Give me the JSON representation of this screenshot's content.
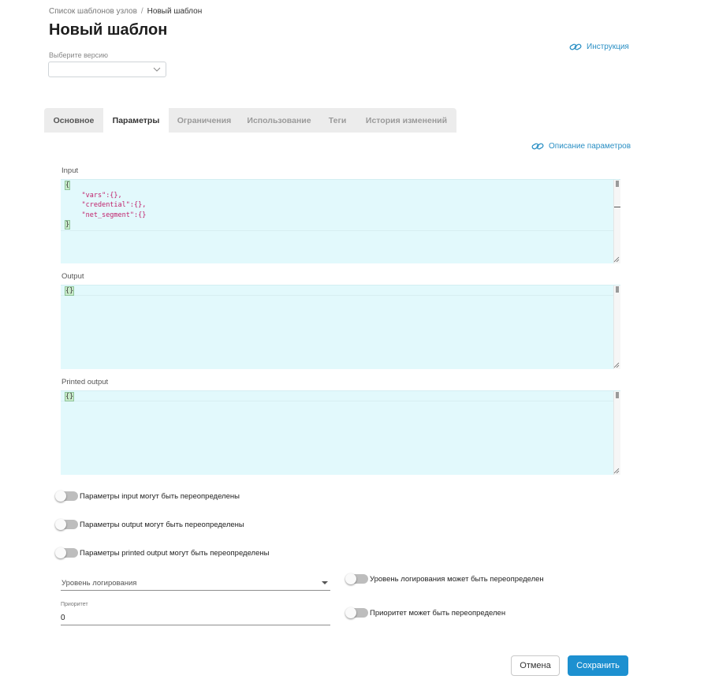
{
  "breadcrumb": {
    "parent": "Список шаблонов узлов",
    "separator": "/",
    "current": "Новый шаблон"
  },
  "page_title": "Новый шаблон",
  "version": {
    "label": "Выберите версию",
    "value": ""
  },
  "links": {
    "instruction": "Инструкция",
    "params_description": "Описание параметров"
  },
  "tabs": [
    {
      "label": "Основное",
      "active": false
    },
    {
      "label": "Параметры",
      "active": true
    },
    {
      "label": "Ограничения",
      "active": false
    },
    {
      "label": "Использование",
      "active": false
    },
    {
      "label": "Теги",
      "active": false
    },
    {
      "label": "История изменений",
      "active": false
    }
  ],
  "editors": {
    "input": {
      "label": "Input",
      "lines": [
        "{",
        "\"vars\":{},",
        "\"credential\":{},",
        "\"net_segment\":{}",
        "}"
      ]
    },
    "output": {
      "label": "Output",
      "value": "{}"
    },
    "printed": {
      "label": "Printed output",
      "value": "{}"
    }
  },
  "toggles": {
    "input_override": "Параметры input могут быть переопределены",
    "output_override": "Параметры output могут быть переопределены",
    "printed_override": "Параметры printed output могут быть переопределены",
    "log_level_override": "Уровень логирования может быть переопределен",
    "priority_override": "Приоритет может быть переопределен"
  },
  "log_level": {
    "placeholder": "Уровень логирования"
  },
  "priority": {
    "label": "Приоритет",
    "value": "0"
  },
  "buttons": {
    "cancel": "Отмена",
    "save": "Сохранить"
  },
  "colors": {
    "accent": "#1d90d0",
    "editor_bg": "#e2f9fc",
    "link": "#2a8fc4",
    "json_key": "#c01f6a"
  }
}
